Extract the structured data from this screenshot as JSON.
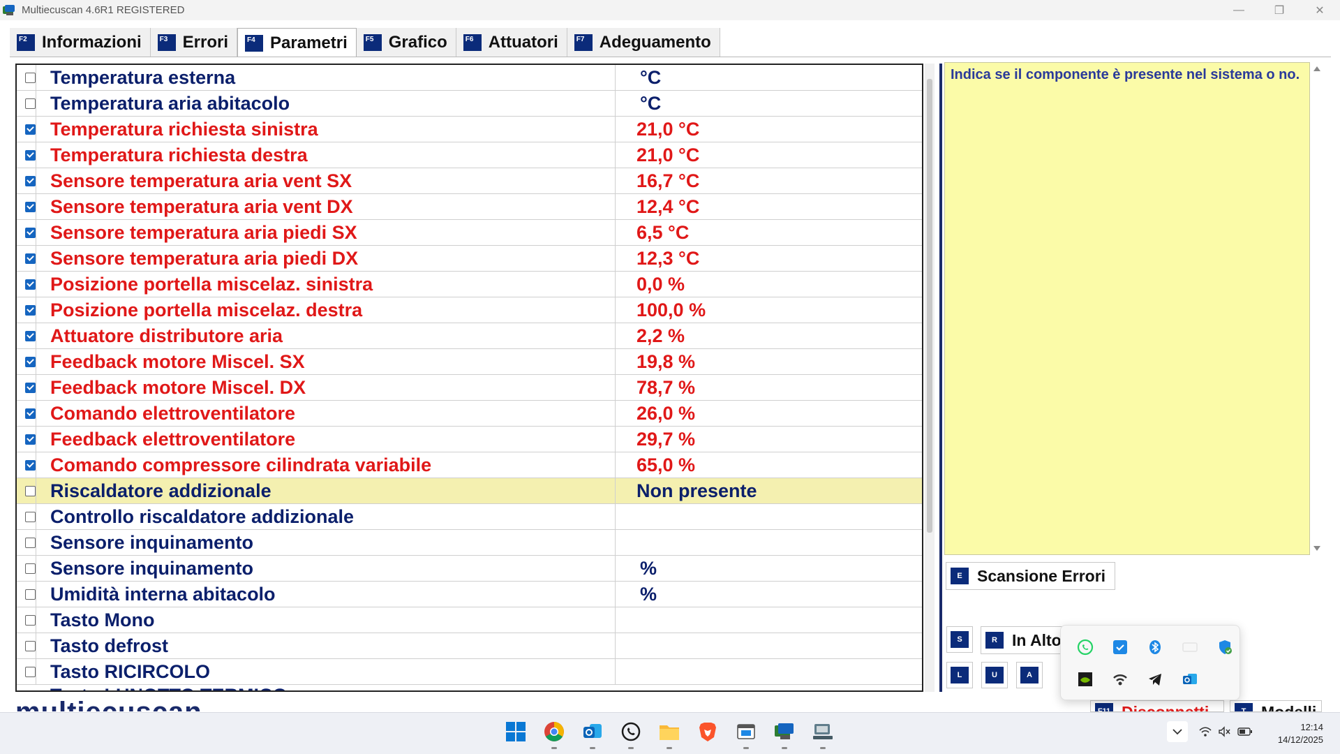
{
  "window": {
    "title": "Multiecuscan 4.6R1 REGISTERED"
  },
  "tabs": [
    {
      "key": "F2",
      "label": "Informazioni"
    },
    {
      "key": "F3",
      "label": "Errori"
    },
    {
      "key": "F4",
      "label": "Parametri",
      "active": true
    },
    {
      "key": "F5",
      "label": "Grafico"
    },
    {
      "key": "F6",
      "label": "Attuatori"
    },
    {
      "key": "F7",
      "label": "Adeguamento"
    }
  ],
  "parameters": [
    {
      "checked": false,
      "name": "Temperatura esterna",
      "value": "°C",
      "color": "#0b1f6b"
    },
    {
      "checked": false,
      "name": "Temperatura aria abitacolo",
      "value": "°C",
      "color": "#0b1f6b"
    },
    {
      "checked": true,
      "name": "Temperatura richiesta sinistra",
      "value": "21,0 °C",
      "color": "#e01818"
    },
    {
      "checked": true,
      "name": "Temperatura richiesta destra",
      "value": "21,0 °C",
      "color": "#e01818"
    },
    {
      "checked": true,
      "name": "Sensore temperatura aria vent SX",
      "value": "16,7 °C",
      "color": "#e01818"
    },
    {
      "checked": true,
      "name": "Sensore temperatura aria vent DX",
      "value": "12,4 °C",
      "color": "#e01818"
    },
    {
      "checked": true,
      "name": "Sensore temperatura aria piedi SX",
      "value": "6,5 °C",
      "color": "#e01818"
    },
    {
      "checked": true,
      "name": "Sensore temperatura aria piedi DX",
      "value": "12,3 °C",
      "color": "#e01818"
    },
    {
      "checked": true,
      "name": "Posizione portella miscelaz. sinistra",
      "value": "0,0 %",
      "color": "#e01818"
    },
    {
      "checked": true,
      "name": "Posizione portella miscelaz. destra",
      "value": "100,0 %",
      "color": "#e01818"
    },
    {
      "checked": true,
      "name": "Attuatore distributore aria",
      "value": "2,2 %",
      "color": "#e01818"
    },
    {
      "checked": true,
      "name": "Feedback motore Miscel. SX",
      "value": "19,8 %",
      "color": "#e01818"
    },
    {
      "checked": true,
      "name": "Feedback motore Miscel. DX",
      "value": "78,7 %",
      "color": "#e01818"
    },
    {
      "checked": true,
      "name": "Comando elettroventilatore",
      "value": "26,0 %",
      "color": "#e01818"
    },
    {
      "checked": true,
      "name": "Feedback elettroventilatore",
      "value": "29,7 %",
      "color": "#e01818"
    },
    {
      "checked": true,
      "name": "Comando compressore cilindrata variabile",
      "value": "65,0 %",
      "color": "#e01818"
    },
    {
      "checked": false,
      "name": "Riscaldatore addizionale",
      "value": "Non presente",
      "color": "#0b1f6b",
      "selected": true
    },
    {
      "checked": false,
      "name": "Controllo riscaldatore addizionale",
      "value": "",
      "color": "#0b1f6b"
    },
    {
      "checked": false,
      "name": "Sensore inquinamento",
      "value": "",
      "color": "#0b1f6b"
    },
    {
      "checked": false,
      "name": "Sensore inquinamento",
      "value": "%",
      "color": "#0b1f6b"
    },
    {
      "checked": false,
      "name": "Umidità interna abitacolo",
      "value": "%",
      "color": "#0b1f6b"
    },
    {
      "checked": false,
      "name": "Tasto Mono",
      "value": "",
      "color": "#0b1f6b"
    },
    {
      "checked": false,
      "name": "Tasto defrost",
      "value": "",
      "color": "#0b1f6b"
    },
    {
      "checked": false,
      "name": "Tasto RICIRCOLO",
      "value": "",
      "color": "#0b1f6b"
    }
  ],
  "partial_row": "Tasto LUNOTTO TERMICO",
  "description": "Indica se il componente è presente nel sistema o no.",
  "buttons": {
    "scan_errors": {
      "key": "E",
      "label": "Scansione Errori"
    },
    "s_key": "S",
    "in_alto": {
      "key": "R",
      "label": "In Alto"
    },
    "l_key": "L",
    "u_key": "U",
    "a_key": "A",
    "disconnect": {
      "key": "F11",
      "label": "Disconnetti"
    },
    "models": {
      "key": "T",
      "label": "Modelli"
    }
  },
  "logo_text": "multiecuscan",
  "tray_icons": [
    "whatsapp-icon",
    "todo-icon",
    "bluetooth-icon",
    "blank-icon",
    "defender-icon",
    "nvidia-icon",
    "vpn-icon",
    "telegram-icon",
    "outlook-icon"
  ],
  "taskbar_icons": [
    "windows-start-icon",
    "chrome-icon",
    "outlook-icon",
    "whatsapp-icon",
    "file-explorer-icon",
    "brave-icon",
    "app-window-icon",
    "multiecuscan-icon",
    "network-app-icon"
  ],
  "clock": {
    "time": "12:14",
    "date": "14/12/2025"
  },
  "colors": {
    "accent": "#0b2b7a",
    "active_value": "#e01818",
    "inactive_value": "#0b1f6b",
    "description_bg": "#fbfba8",
    "selected_row": "#f4f0b0"
  }
}
